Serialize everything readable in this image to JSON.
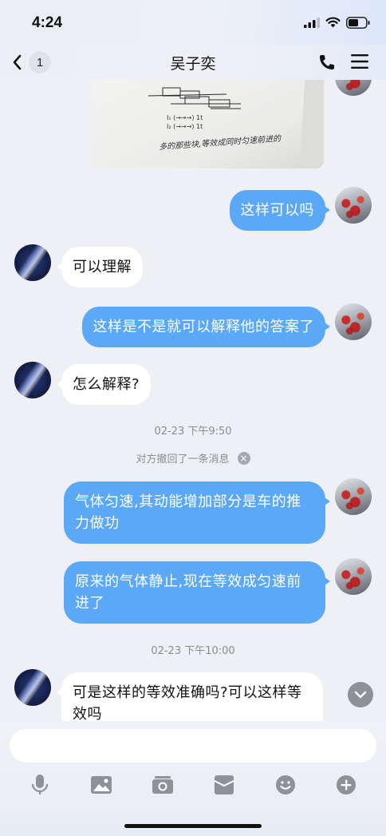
{
  "status": {
    "time": "4:24"
  },
  "nav": {
    "back_count": "1",
    "title": "吴子奕"
  },
  "messages": [
    {
      "side": "out",
      "text": "这样可以吗"
    },
    {
      "side": "in",
      "text": "可以理解"
    },
    {
      "side": "out",
      "text": "这样是不是就可以解释他的答案了"
    },
    {
      "side": "in",
      "text": "怎么解释?"
    },
    {
      "side": "out",
      "text": "气体匀速,其动能增加部分是车的推力做功"
    },
    {
      "side": "out",
      "text": "原来的气体静止,现在等效成匀速前进了"
    },
    {
      "side": "in",
      "text": "可是这样的等效准确吗?可以这样等效吗"
    }
  ],
  "timestamps": [
    "02-23 下午9:50",
    "02-23 下午10:00"
  ],
  "recall_notice": "对方撤回了一条消息",
  "image_message": {
    "handwriting_line1": "I₁ (→→→) 1t",
    "handwriting_line2": "I₂ (→→→) 1t",
    "handwriting_line3": "多的那些块,等效成同时匀速前进的"
  },
  "input": {
    "placeholder": ""
  },
  "toolbar_icons": [
    "microphone-icon",
    "image-icon",
    "camera-icon",
    "red-packet-icon",
    "emoji-icon",
    "plus-icon"
  ],
  "colors": {
    "bubble_out": "#5aa8f6",
    "bubble_in": "#ffffff",
    "background": "#eef0f6"
  }
}
